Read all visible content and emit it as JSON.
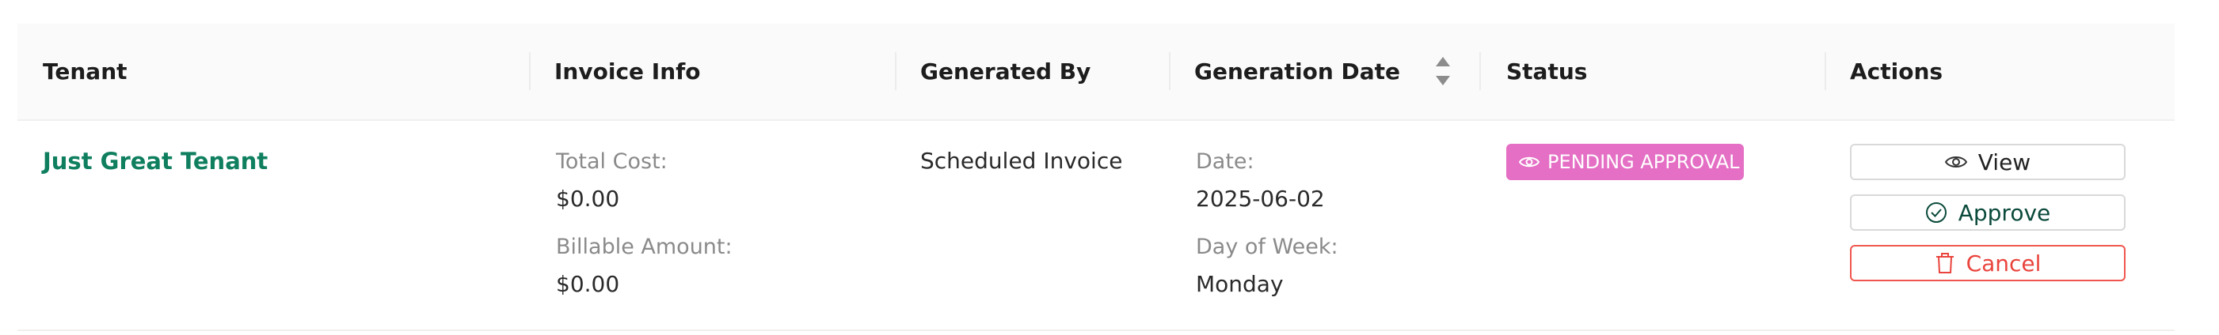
{
  "table": {
    "columns": {
      "tenant": "Tenant",
      "invoice_info": "Invoice Info",
      "generated_by": "Generated By",
      "generation_date": "Generation Date",
      "status": "Status",
      "actions": "Actions"
    },
    "rows": [
      {
        "tenant": "Just Great Tenant",
        "invoice": {
          "total_cost_label": "Total Cost:",
          "total_cost": "$0.00",
          "billable_amount_label": "Billable Amount:",
          "billable_amount": "$0.00"
        },
        "generated_by": "Scheduled Invoice",
        "generation": {
          "date_label": "Date:",
          "date": "2025-06-02",
          "day_label": "Day of Week:",
          "day": "Monday"
        },
        "status": "PENDING APPROVAL",
        "actions": {
          "view": "View",
          "approve": "Approve",
          "cancel": "Cancel"
        }
      }
    ]
  },
  "colors": {
    "accent": "#0f7f5f",
    "status_pending": "#e46fc4",
    "danger": "#e9443c",
    "header_bg": "#fafafa"
  },
  "icons": {
    "sort": "sort-icon",
    "status": "eye-icon",
    "view": "eye-icon",
    "approve": "check-circle-icon",
    "cancel": "trash-icon"
  }
}
